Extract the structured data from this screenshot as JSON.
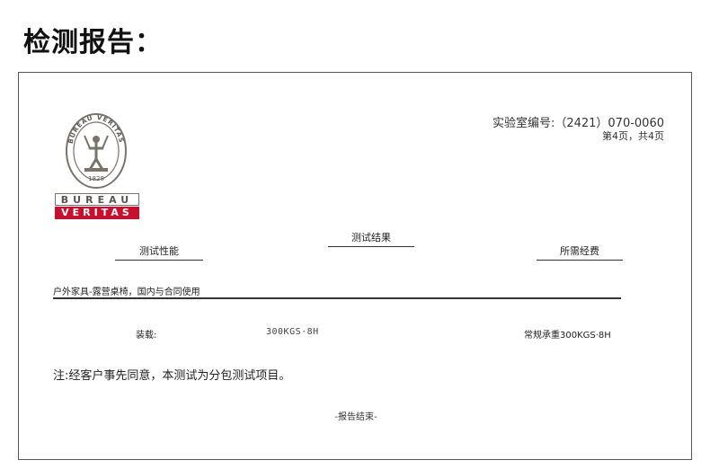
{
  "page_heading": "检测报告：",
  "report": {
    "logo": {
      "brand_top": "BUREAU",
      "brand_bottom": "VERITAS",
      "seal_ring_text": "BUREAU VERITAS",
      "seal_year": "1828",
      "colors": {
        "brand_red": "#c8102e",
        "seal_gray": "#7a736c"
      }
    },
    "report_no": "实验室编号:（2421）070-0060",
    "page_count": "第4页，共4页",
    "headers": {
      "test_results": "测试结果",
      "test_performance": "测试性能",
      "requirement": "所需经费"
    },
    "product_scope": "户外家具-露营桌椅，国内与合同使用",
    "load": {
      "label": "装载:",
      "value": "300KGS·8H",
      "requirement": "常规承重300KGS·8H"
    },
    "note": "注:经客户事先同意，本测试为分包测试项目。",
    "end_text": "-报告结束-"
  }
}
